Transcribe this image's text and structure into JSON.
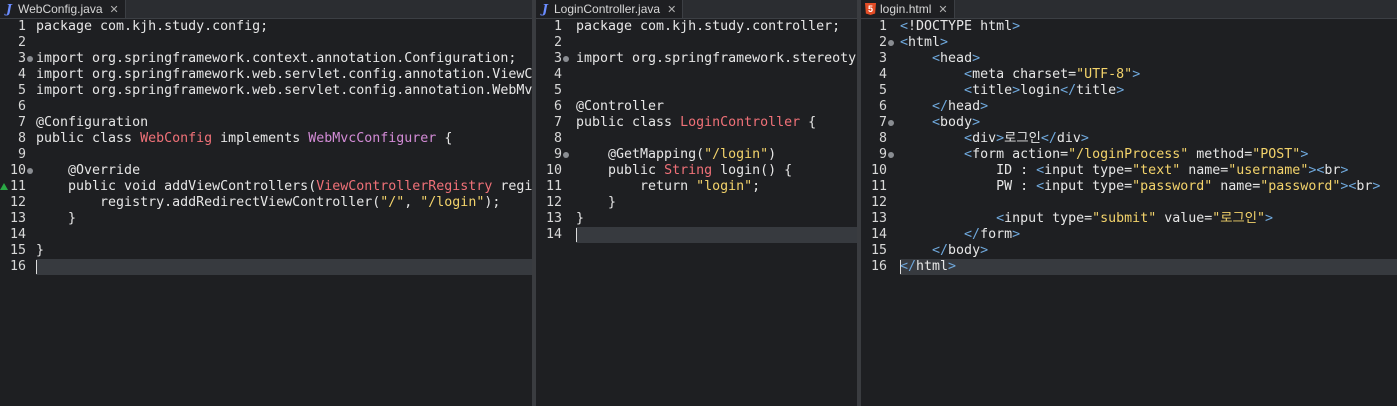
{
  "colors": {
    "background": "#1e1f22",
    "keyword": "#e6e6e6",
    "class_name": "#f07178",
    "interface_name": "#d38bd6",
    "string": "#f3d36b",
    "html_tag_bracket": "#6fa8dc",
    "current_line": "#373a3f"
  },
  "editors": [
    {
      "tab": {
        "label": "WebConfig.java",
        "icon": "java-file-icon"
      },
      "lines": [
        {
          "n": "1",
          "segs": [
            [
              "plain",
              "package com.kjh.study.config;"
            ]
          ]
        },
        {
          "n": "2",
          "segs": []
        },
        {
          "n": "3",
          "fold": true,
          "segs": [
            [
              "plain",
              "import org.springframework.context.annotation.Configuration;"
            ]
          ]
        },
        {
          "n": "4",
          "segs": [
            [
              "plain",
              "import org.springframework.web.servlet.config.annotation.ViewControllerRegistry;"
            ]
          ]
        },
        {
          "n": "5",
          "segs": [
            [
              "plain",
              "import org.springframework.web.servlet.config.annotation.WebMvcConfigurer;"
            ]
          ]
        },
        {
          "n": "6",
          "segs": []
        },
        {
          "n": "7",
          "segs": [
            [
              "ann",
              "@Configuration"
            ]
          ]
        },
        {
          "n": "8",
          "segs": [
            [
              "k",
              "public class "
            ],
            [
              "cls",
              "WebConfig"
            ],
            [
              "k",
              " implements "
            ],
            [
              "iface",
              "WebMvcConfigurer"
            ],
            [
              "plain",
              " {"
            ]
          ]
        },
        {
          "n": "9",
          "segs": []
        },
        {
          "n": "10",
          "fold": true,
          "segs": [
            [
              "ann",
              "    @Override"
            ]
          ]
        },
        {
          "n": "11",
          "marker": true,
          "segs": [
            [
              "k",
              "    public void "
            ],
            [
              "plain",
              "addViewControllers("
            ],
            [
              "cls",
              "ViewControllerRegistry"
            ],
            [
              "plain",
              " registry) {"
            ]
          ]
        },
        {
          "n": "12",
          "segs": [
            [
              "plain",
              "        registry.addRedirectViewController("
            ],
            [
              "str",
              "\"/\""
            ],
            [
              "plain",
              ", "
            ],
            [
              "str",
              "\"/login\""
            ],
            [
              "plain",
              ");"
            ]
          ]
        },
        {
          "n": "13",
          "segs": [
            [
              "plain",
              "    }"
            ]
          ]
        },
        {
          "n": "14",
          "segs": []
        },
        {
          "n": "15",
          "segs": [
            [
              "plain",
              "}"
            ]
          ]
        },
        {
          "n": "16",
          "current": true,
          "segs": []
        }
      ]
    },
    {
      "tab": {
        "label": "LoginController.java",
        "icon": "java-file-icon"
      },
      "lines": [
        {
          "n": "1",
          "segs": [
            [
              "plain",
              "package com.kjh.study.controller;"
            ]
          ]
        },
        {
          "n": "2",
          "segs": []
        },
        {
          "n": "3",
          "fold": true,
          "segs": [
            [
              "plain",
              "import org.springframework.stereotype.Controller;"
            ]
          ]
        },
        {
          "n": "4",
          "segs": []
        },
        {
          "n": "5",
          "segs": []
        },
        {
          "n": "6",
          "segs": [
            [
              "ann",
              "@Controller"
            ]
          ]
        },
        {
          "n": "7",
          "segs": [
            [
              "k",
              "public class "
            ],
            [
              "cls",
              "LoginController"
            ],
            [
              "plain",
              " {"
            ]
          ]
        },
        {
          "n": "8",
          "segs": []
        },
        {
          "n": "9",
          "fold": true,
          "segs": [
            [
              "ann",
              "    @GetMapping("
            ],
            [
              "str",
              "\"/login\""
            ],
            [
              "ann",
              ")"
            ]
          ]
        },
        {
          "n": "10",
          "segs": [
            [
              "k",
              "    public "
            ],
            [
              "cls",
              "String"
            ],
            [
              "plain",
              " login() {"
            ]
          ]
        },
        {
          "n": "11",
          "segs": [
            [
              "k",
              "        return "
            ],
            [
              "str",
              "\"login\""
            ],
            [
              "plain",
              ";"
            ]
          ]
        },
        {
          "n": "12",
          "segs": [
            [
              "plain",
              "    }"
            ]
          ]
        },
        {
          "n": "13",
          "segs": [
            [
              "plain",
              "}"
            ]
          ]
        },
        {
          "n": "14",
          "current": true,
          "segs": []
        }
      ]
    },
    {
      "tab": {
        "label": "login.html",
        "icon": "html5-file-icon"
      },
      "lines": [
        {
          "n": "1",
          "segs": [
            [
              "tag",
              "<"
            ],
            [
              "plain",
              "!DOCTYPE html"
            ],
            [
              "tag",
              ">"
            ]
          ]
        },
        {
          "n": "2",
          "fold": true,
          "segs": [
            [
              "tag",
              "<"
            ],
            [
              "plain",
              "html"
            ],
            [
              "tag",
              ">"
            ]
          ]
        },
        {
          "n": "3",
          "segs": [
            [
              "plain",
              "    "
            ],
            [
              "tag",
              "<"
            ],
            [
              "plain",
              "head"
            ],
            [
              "tag",
              ">"
            ]
          ]
        },
        {
          "n": "4",
          "segs": [
            [
              "plain",
              "        "
            ],
            [
              "tag",
              "<"
            ],
            [
              "plain",
              "meta charset="
            ],
            [
              "aval",
              "\"UTF-8\""
            ],
            [
              "tag",
              ">"
            ]
          ]
        },
        {
          "n": "5",
          "segs": [
            [
              "plain",
              "        "
            ],
            [
              "tag",
              "<"
            ],
            [
              "plain",
              "title"
            ],
            [
              "tag",
              ">"
            ],
            [
              "plain",
              "login"
            ],
            [
              "tag",
              "</"
            ],
            [
              "plain",
              "title"
            ],
            [
              "tag",
              ">"
            ]
          ]
        },
        {
          "n": "6",
          "segs": [
            [
              "plain",
              "    "
            ],
            [
              "tag",
              "</"
            ],
            [
              "plain",
              "head"
            ],
            [
              "tag",
              ">"
            ]
          ]
        },
        {
          "n": "7",
          "fold": true,
          "segs": [
            [
              "plain",
              "    "
            ],
            [
              "tag",
              "<"
            ],
            [
              "plain",
              "body"
            ],
            [
              "tag",
              ">"
            ]
          ]
        },
        {
          "n": "8",
          "segs": [
            [
              "plain",
              "        "
            ],
            [
              "tag",
              "<"
            ],
            [
              "plain",
              "div"
            ],
            [
              "tag",
              ">"
            ],
            [
              "plain",
              "로그인"
            ],
            [
              "tag",
              "</"
            ],
            [
              "plain",
              "div"
            ],
            [
              "tag",
              ">"
            ]
          ]
        },
        {
          "n": "9",
          "fold": true,
          "segs": [
            [
              "plain",
              "        "
            ],
            [
              "tag",
              "<"
            ],
            [
              "plain",
              "form action="
            ],
            [
              "aval",
              "\"/loginProcess\""
            ],
            [
              "plain",
              " method="
            ],
            [
              "aval",
              "\"POST\""
            ],
            [
              "tag",
              ">"
            ]
          ]
        },
        {
          "n": "10",
          "segs": [
            [
              "plain",
              "            ID : "
            ],
            [
              "tag",
              "<"
            ],
            [
              "plain",
              "input type="
            ],
            [
              "aval",
              "\"text\""
            ],
            [
              "plain",
              " name="
            ],
            [
              "aval",
              "\"username\""
            ],
            [
              "tag",
              "><"
            ],
            [
              "plain",
              "br"
            ],
            [
              "tag",
              ">"
            ]
          ]
        },
        {
          "n": "11",
          "segs": [
            [
              "plain",
              "            PW : "
            ],
            [
              "tag",
              "<"
            ],
            [
              "plain",
              "input type="
            ],
            [
              "aval",
              "\"password\""
            ],
            [
              "plain",
              " name="
            ],
            [
              "aval",
              "\"password\""
            ],
            [
              "tag",
              "><"
            ],
            [
              "plain",
              "br"
            ],
            [
              "tag",
              ">"
            ]
          ]
        },
        {
          "n": "12",
          "segs": []
        },
        {
          "n": "13",
          "segs": [
            [
              "plain",
              "            "
            ],
            [
              "tag",
              "<"
            ],
            [
              "plain",
              "input type="
            ],
            [
              "aval",
              "\"submit\""
            ],
            [
              "plain",
              " value="
            ],
            [
              "aval",
              "\"로그인\""
            ],
            [
              "tag",
              ">"
            ]
          ]
        },
        {
          "n": "14",
          "segs": [
            [
              "plain",
              "        "
            ],
            [
              "tag",
              "</"
            ],
            [
              "plain",
              "form"
            ],
            [
              "tag",
              ">"
            ]
          ]
        },
        {
          "n": "15",
          "segs": [
            [
              "plain",
              "    "
            ],
            [
              "tag",
              "</"
            ],
            [
              "plain",
              "body"
            ],
            [
              "tag",
              ">"
            ]
          ]
        },
        {
          "n": "16",
          "current": true,
          "segs": [
            [
              "tag",
              "</"
            ],
            [
              "plain",
              "html"
            ],
            [
              "tag",
              ">"
            ]
          ]
        }
      ]
    }
  ]
}
